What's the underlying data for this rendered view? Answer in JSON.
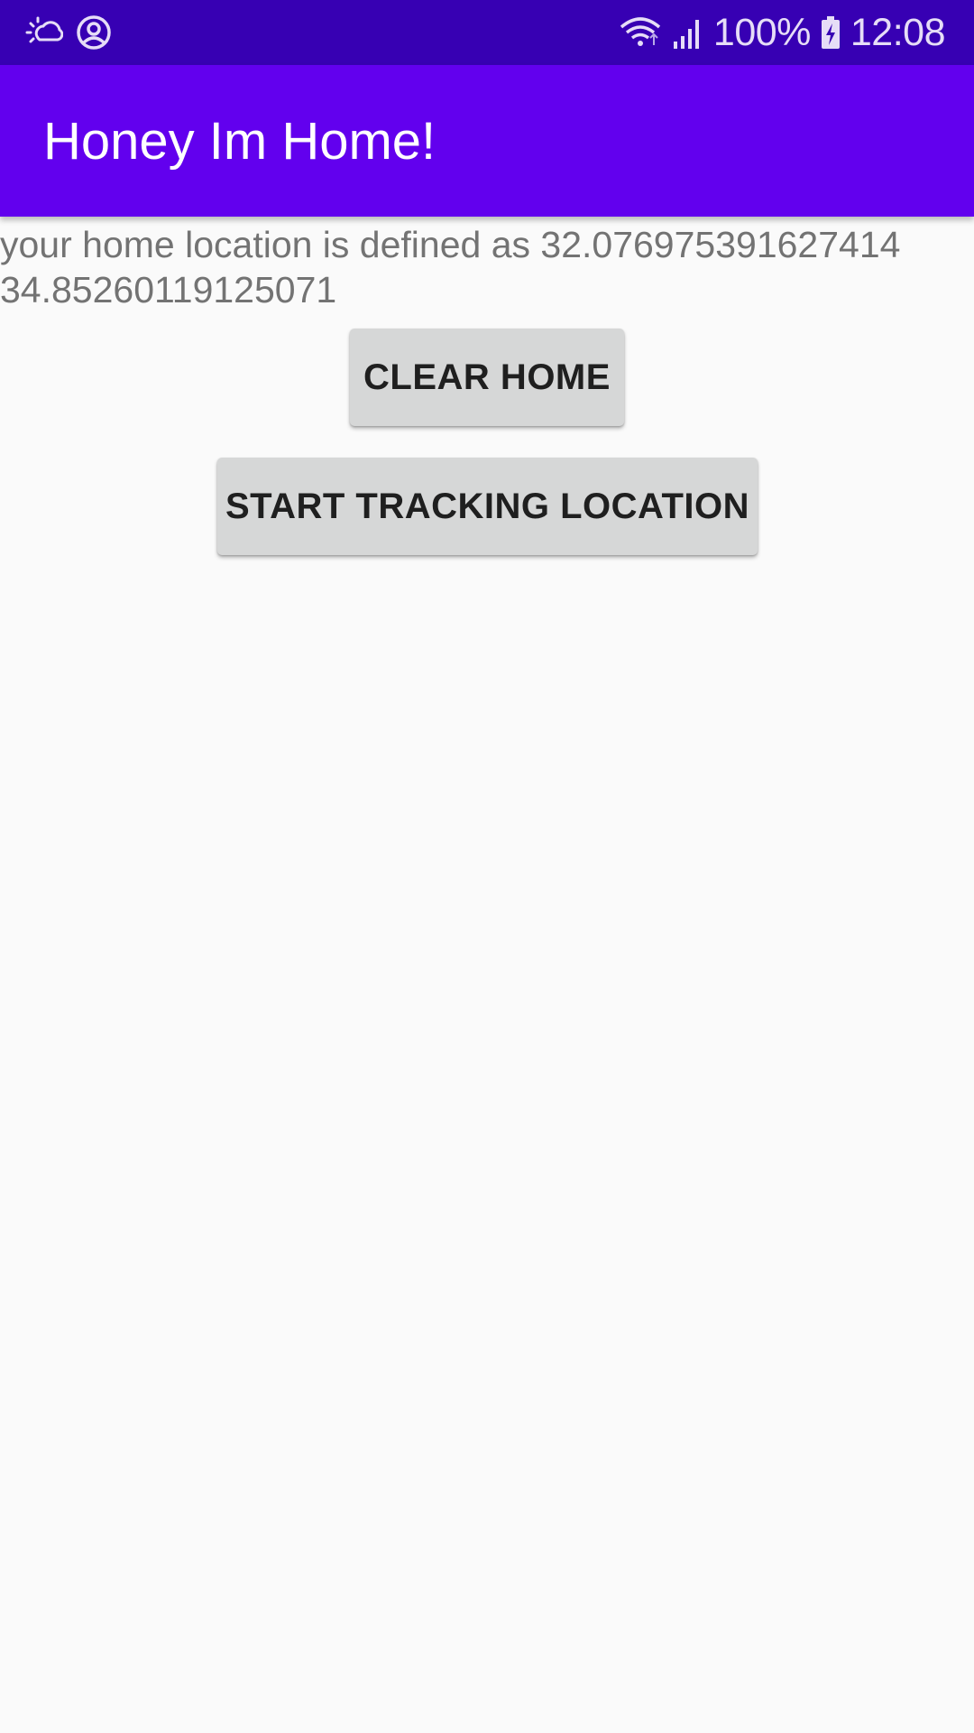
{
  "status_bar": {
    "left_icons": [
      "weather-cloud-icon",
      "account-circle-icon"
    ],
    "right_icons": [
      "wifi-icon",
      "signal-icon",
      "battery-charging-icon"
    ],
    "battery_percent": "100%",
    "time": "12:08",
    "background_color": "#3700B3"
  },
  "app_bar": {
    "title": "Honey Im Home!",
    "background_color": "#6200EE"
  },
  "main": {
    "home_location_text": "your home location is defined as 32.076975391627414\n34.85260119125071",
    "clear_home_label": "CLEAR HOME",
    "start_tracking_label": "START TRACKING LOCATION"
  },
  "colors": {
    "background": "#FAFAFA",
    "button": "#D6D7D7",
    "text_secondary": "#737373"
  }
}
